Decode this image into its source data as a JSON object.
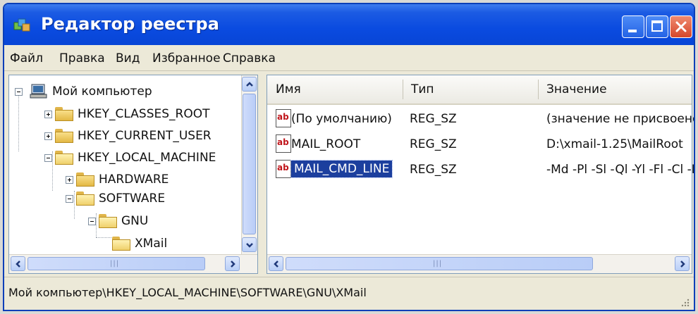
{
  "window": {
    "title": "Редактор реестра"
  },
  "menu": {
    "items": [
      "Файл",
      "Правка",
      "Вид",
      "Избранное",
      "Справка"
    ]
  },
  "tree": {
    "root": "Мой компьютер",
    "nodes": [
      {
        "label": "HKEY_CLASSES_ROOT",
        "expander": "plus"
      },
      {
        "label": "HKEY_CURRENT_USER",
        "expander": "plus"
      },
      {
        "label": "HKEY_LOCAL_MACHINE",
        "expander": "minus"
      },
      {
        "label": "HARDWARE",
        "expander": "plus"
      },
      {
        "label": "SOFTWARE",
        "expander": "minus"
      },
      {
        "label": "GNU",
        "expander": "minus"
      },
      {
        "label": "XMail",
        "expander": "none"
      }
    ],
    "scroll_grip": "|||"
  },
  "list": {
    "columns": {
      "name": "Имя",
      "type": "Тип",
      "value": "Значение"
    },
    "icon_text": "ab",
    "rows": [
      {
        "name": "(По умолчанию)",
        "type": "REG_SZ",
        "value": "(значение не присвоено)",
        "selected": false
      },
      {
        "name": "MAIL_ROOT",
        "type": "REG_SZ",
        "value": "D:\\xmail-1.25\\MailRoot",
        "selected": false
      },
      {
        "name": "MAIL_CMD_LINE",
        "type": "REG_SZ",
        "value": "-Md -Pl -Sl -Ql -Yl -Fl -Cl -Ll",
        "selected": true
      }
    ],
    "scroll_grip": "|||"
  },
  "status": {
    "path": "Мой компьютер\\HKEY_LOCAL_MACHINE\\SOFTWARE\\GNU\\XMail"
  },
  "colors": {
    "titlebar": "#0a4be0",
    "selection": "#1c3f9e",
    "close_button": "#d5472b"
  }
}
